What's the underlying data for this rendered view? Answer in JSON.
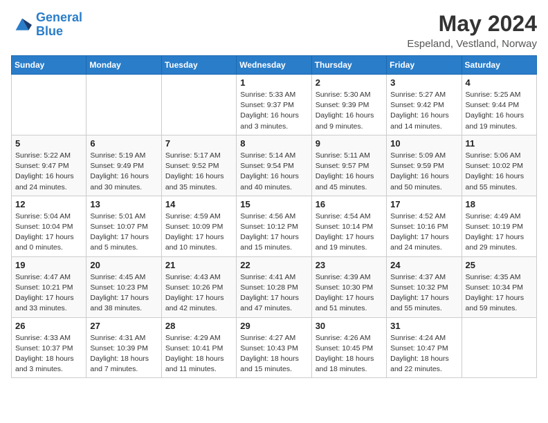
{
  "header": {
    "logo_line1": "General",
    "logo_line2": "Blue",
    "month_title": "May 2024",
    "location": "Espeland, Vestland, Norway"
  },
  "days_of_week": [
    "Sunday",
    "Monday",
    "Tuesday",
    "Wednesday",
    "Thursday",
    "Friday",
    "Saturday"
  ],
  "weeks": [
    [
      {
        "num": "",
        "info": ""
      },
      {
        "num": "",
        "info": ""
      },
      {
        "num": "",
        "info": ""
      },
      {
        "num": "1",
        "info": "Sunrise: 5:33 AM\nSunset: 9:37 PM\nDaylight: 16 hours\nand 3 minutes."
      },
      {
        "num": "2",
        "info": "Sunrise: 5:30 AM\nSunset: 9:39 PM\nDaylight: 16 hours\nand 9 minutes."
      },
      {
        "num": "3",
        "info": "Sunrise: 5:27 AM\nSunset: 9:42 PM\nDaylight: 16 hours\nand 14 minutes."
      },
      {
        "num": "4",
        "info": "Sunrise: 5:25 AM\nSunset: 9:44 PM\nDaylight: 16 hours\nand 19 minutes."
      }
    ],
    [
      {
        "num": "5",
        "info": "Sunrise: 5:22 AM\nSunset: 9:47 PM\nDaylight: 16 hours\nand 24 minutes."
      },
      {
        "num": "6",
        "info": "Sunrise: 5:19 AM\nSunset: 9:49 PM\nDaylight: 16 hours\nand 30 minutes."
      },
      {
        "num": "7",
        "info": "Sunrise: 5:17 AM\nSunset: 9:52 PM\nDaylight: 16 hours\nand 35 minutes."
      },
      {
        "num": "8",
        "info": "Sunrise: 5:14 AM\nSunset: 9:54 PM\nDaylight: 16 hours\nand 40 minutes."
      },
      {
        "num": "9",
        "info": "Sunrise: 5:11 AM\nSunset: 9:57 PM\nDaylight: 16 hours\nand 45 minutes."
      },
      {
        "num": "10",
        "info": "Sunrise: 5:09 AM\nSunset: 9:59 PM\nDaylight: 16 hours\nand 50 minutes."
      },
      {
        "num": "11",
        "info": "Sunrise: 5:06 AM\nSunset: 10:02 PM\nDaylight: 16 hours\nand 55 minutes."
      }
    ],
    [
      {
        "num": "12",
        "info": "Sunrise: 5:04 AM\nSunset: 10:04 PM\nDaylight: 17 hours\nand 0 minutes."
      },
      {
        "num": "13",
        "info": "Sunrise: 5:01 AM\nSunset: 10:07 PM\nDaylight: 17 hours\nand 5 minutes."
      },
      {
        "num": "14",
        "info": "Sunrise: 4:59 AM\nSunset: 10:09 PM\nDaylight: 17 hours\nand 10 minutes."
      },
      {
        "num": "15",
        "info": "Sunrise: 4:56 AM\nSunset: 10:12 PM\nDaylight: 17 hours\nand 15 minutes."
      },
      {
        "num": "16",
        "info": "Sunrise: 4:54 AM\nSunset: 10:14 PM\nDaylight: 17 hours\nand 19 minutes."
      },
      {
        "num": "17",
        "info": "Sunrise: 4:52 AM\nSunset: 10:16 PM\nDaylight: 17 hours\nand 24 minutes."
      },
      {
        "num": "18",
        "info": "Sunrise: 4:49 AM\nSunset: 10:19 PM\nDaylight: 17 hours\nand 29 minutes."
      }
    ],
    [
      {
        "num": "19",
        "info": "Sunrise: 4:47 AM\nSunset: 10:21 PM\nDaylight: 17 hours\nand 33 minutes."
      },
      {
        "num": "20",
        "info": "Sunrise: 4:45 AM\nSunset: 10:23 PM\nDaylight: 17 hours\nand 38 minutes."
      },
      {
        "num": "21",
        "info": "Sunrise: 4:43 AM\nSunset: 10:26 PM\nDaylight: 17 hours\nand 42 minutes."
      },
      {
        "num": "22",
        "info": "Sunrise: 4:41 AM\nSunset: 10:28 PM\nDaylight: 17 hours\nand 47 minutes."
      },
      {
        "num": "23",
        "info": "Sunrise: 4:39 AM\nSunset: 10:30 PM\nDaylight: 17 hours\nand 51 minutes."
      },
      {
        "num": "24",
        "info": "Sunrise: 4:37 AM\nSunset: 10:32 PM\nDaylight: 17 hours\nand 55 minutes."
      },
      {
        "num": "25",
        "info": "Sunrise: 4:35 AM\nSunset: 10:34 PM\nDaylight: 17 hours\nand 59 minutes."
      }
    ],
    [
      {
        "num": "26",
        "info": "Sunrise: 4:33 AM\nSunset: 10:37 PM\nDaylight: 18 hours\nand 3 minutes."
      },
      {
        "num": "27",
        "info": "Sunrise: 4:31 AM\nSunset: 10:39 PM\nDaylight: 18 hours\nand 7 minutes."
      },
      {
        "num": "28",
        "info": "Sunrise: 4:29 AM\nSunset: 10:41 PM\nDaylight: 18 hours\nand 11 minutes."
      },
      {
        "num": "29",
        "info": "Sunrise: 4:27 AM\nSunset: 10:43 PM\nDaylight: 18 hours\nand 15 minutes."
      },
      {
        "num": "30",
        "info": "Sunrise: 4:26 AM\nSunset: 10:45 PM\nDaylight: 18 hours\nand 18 minutes."
      },
      {
        "num": "31",
        "info": "Sunrise: 4:24 AM\nSunset: 10:47 PM\nDaylight: 18 hours\nand 22 minutes."
      },
      {
        "num": "",
        "info": ""
      }
    ]
  ]
}
